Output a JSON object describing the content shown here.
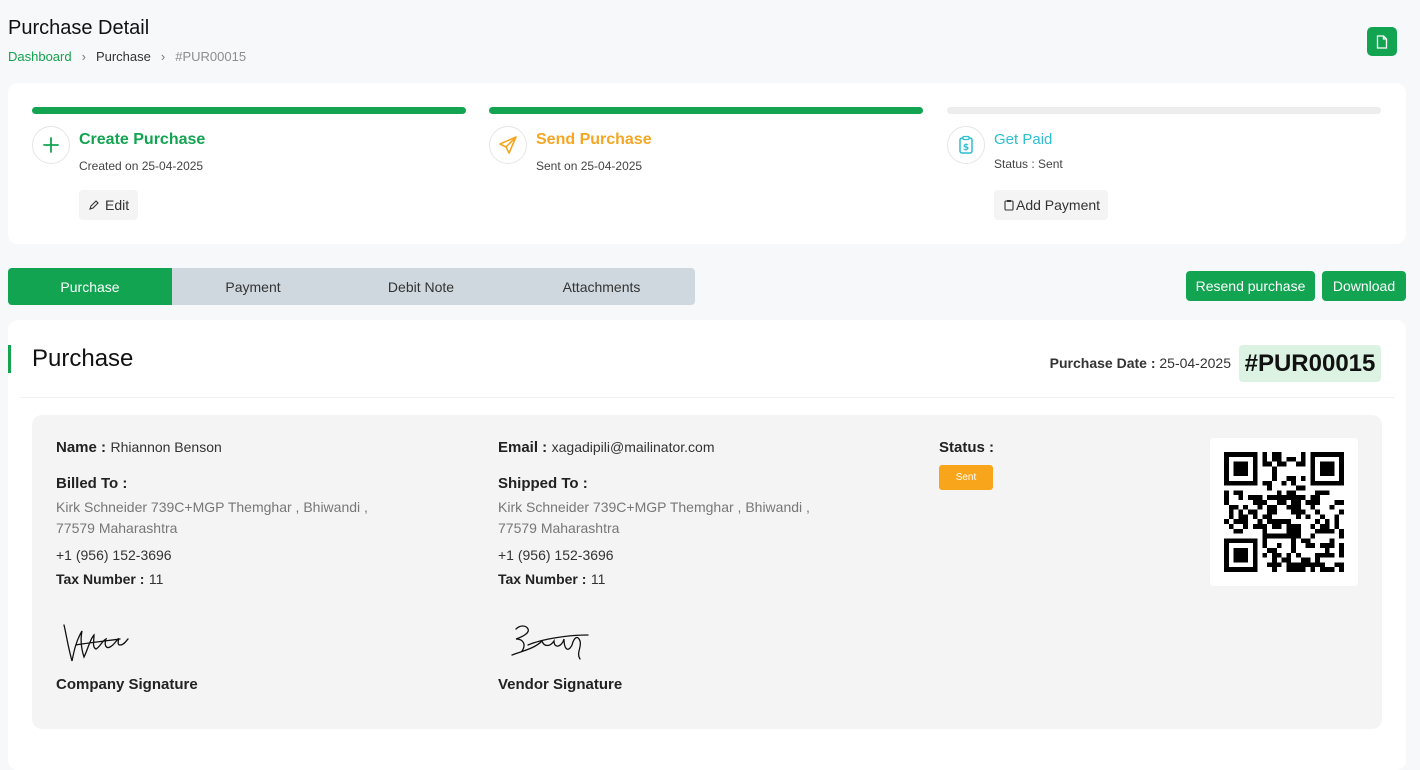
{
  "header": {
    "title": "Purchase Detail",
    "breadcrumb": [
      "Dashboard",
      "Purchase",
      "#PUR00015"
    ],
    "breadcrumb_sep": "›"
  },
  "steps": [
    {
      "title": "Create Purchase",
      "subtitle": "Created on 25-04-2025",
      "action": "Edit",
      "icon": "plus-icon",
      "color": "#12a451",
      "done": true
    },
    {
      "title": "Send Purchase",
      "subtitle": "Sent on 25-04-2025",
      "icon": "send-icon",
      "color": "#f5a623",
      "done": true
    },
    {
      "title": "Get Paid",
      "subtitle": "Status : Sent",
      "action": "Add Payment",
      "icon": "clipboard-dollar-icon",
      "color": "#2bbfcf",
      "done": false
    }
  ],
  "tabs": [
    "Purchase",
    "Payment",
    "Debit Note",
    "Attachments"
  ],
  "active_tab": "Purchase",
  "actions": {
    "resend": "Resend purchase",
    "download": "Download"
  },
  "purchase": {
    "heading": "Purchase",
    "date_label": "Purchase Date :",
    "date": "25-04-2025",
    "number": "#PUR00015",
    "name_label": "Name :",
    "name": "Rhiannon Benson",
    "email_label": "Email :",
    "email": "xagadipili@mailinator.com",
    "status_label": "Status :",
    "status": "Sent",
    "billed": {
      "label": "Billed To :",
      "address1": "Kirk Schneider 739C+MGP Themghar , Bhiwandi ,",
      "address2": "77579 Maharashtra",
      "phone": "+1 (956) 152-3696",
      "tax_label": "Tax Number :",
      "tax": "11"
    },
    "shipped": {
      "label": "Shipped To :",
      "address1": "Kirk Schneider 739C+MGP Themghar , Bhiwandi ,",
      "address2": "77579 Maharashtra",
      "phone": "+1 (956) 152-3696",
      "tax_label": "Tax Number :",
      "tax": "11"
    },
    "company_signature": "Company Signature",
    "vendor_signature": "Vendor Signature"
  },
  "colors": {
    "primary": "#12a451",
    "warning": "#f8a51b",
    "info": "#2bbfcf",
    "number_bg": "#dcf2e3"
  }
}
